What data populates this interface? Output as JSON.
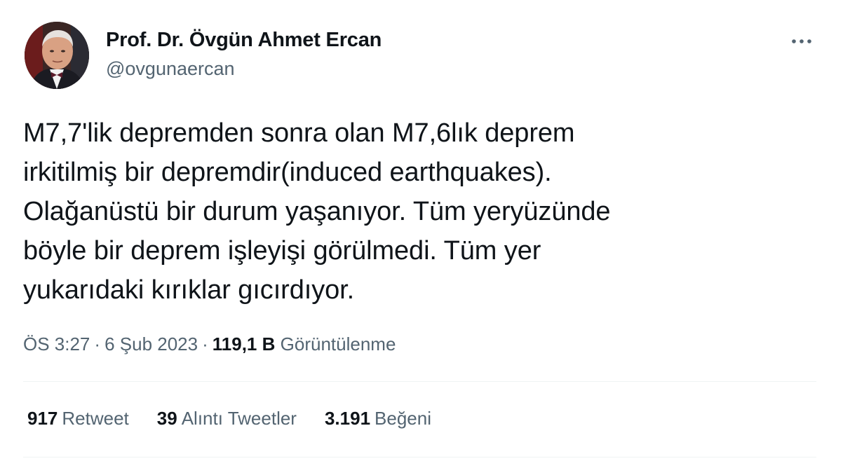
{
  "author": {
    "display_name": "Prof. Dr. Övgün Ahmet Ercan",
    "handle": "@ovgunaercan"
  },
  "tweet": {
    "text": "M7,7'lik depremden sonra olan M7,6lık deprem\nirkitilmiş bir depremdir(induced earthquakes).\nOlağanüstü bir durum yaşanıyor. Tüm yeryüzünde\nböyle bir deprem işleyişi görülmedi. Tüm yer\nyukarıdaki kırıklar gıcırdıyor.",
    "time": "ÖS 3:27",
    "date": "6 Şub 2023",
    "separator": "·",
    "views_count": "119,1 B",
    "views_label": "Görüntülenme"
  },
  "stats": {
    "retweets": {
      "count": "917",
      "label": "Retweet"
    },
    "quotes": {
      "count": "39",
      "label": "Alıntı Tweetler"
    },
    "likes": {
      "count": "3.191",
      "label": "Beğeni"
    }
  },
  "colors": {
    "text_primary": "#0f1419",
    "text_secondary": "#536471",
    "divider": "#eff3f4"
  },
  "icons": {
    "more": "more-horizontal-icon"
  }
}
